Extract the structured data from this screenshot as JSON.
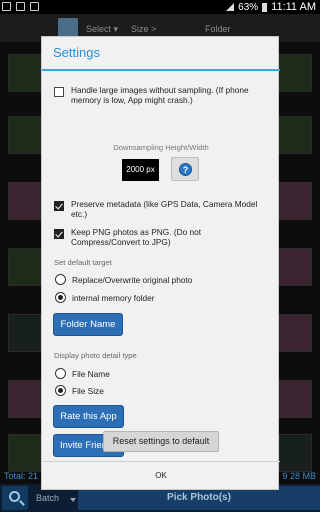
{
  "status_bar": {
    "battery": "63%",
    "time": "11:11 AM"
  },
  "toolbar": {
    "select": "Select ▾",
    "size": "Size >",
    "folder": "Folder"
  },
  "background": {
    "total_left": "Total: 21",
    "total_right": "9 28 MB"
  },
  "bottom_bar": {
    "batch": "Batch",
    "pick": "Pick Photo(s)"
  },
  "dialog": {
    "title": "Settings",
    "handle_large": {
      "label": "Handle large images without sampling. (If phone memory is low, App might crash.)",
      "checked": false
    },
    "downsampling_caption": "Downsampling Height/Width",
    "downsampling_value": "2000 px",
    "help_glyph": "?",
    "preserve_metadata": {
      "label": "Preserve metadata (like GPS Data, Camera Model etc.)",
      "checked": true
    },
    "keep_png": {
      "label": "Keep PNG photos as PNG. (Do not Compress/Convert to JPG)",
      "checked": true
    },
    "default_target_caption": "Set default target",
    "target_options": [
      {
        "label": "Replace/Overwrite original photo",
        "selected": false
      },
      {
        "label": "internal memory folder",
        "selected": true
      }
    ],
    "folder_name_button": "Folder Name",
    "detail_type_caption": "Display photo detail type",
    "detail_options": [
      {
        "label": "File Name",
        "selected": false
      },
      {
        "label": "File Size",
        "selected": true
      }
    ],
    "rate_button": "Rate this App",
    "invite_button": "Invite Friends",
    "reset_button": "Reset settings to default",
    "ok_button": "OK"
  }
}
